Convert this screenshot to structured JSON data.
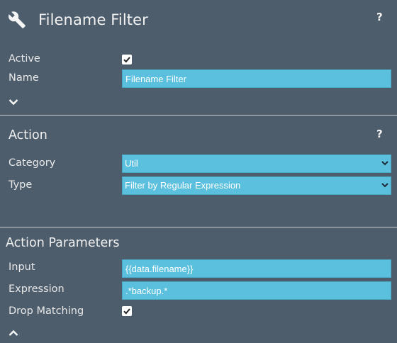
{
  "header": {
    "icon": "wrench-icon",
    "title": "Filename Filter",
    "help_label": "?"
  },
  "general": {
    "active_label": "Active",
    "active_checked": true,
    "name_label": "Name",
    "name_value": "Filename Filter",
    "toggle_icon": "chevron-down-icon"
  },
  "action": {
    "title": "Action",
    "help_label": "?",
    "category_label": "Category",
    "category_value": "Util",
    "category_options": [
      "Util"
    ],
    "type_label": "Type",
    "type_value": "Filter by Regular Expression",
    "type_options": [
      "Filter by Regular Expression"
    ]
  },
  "parameters": {
    "title": "Action Parameters",
    "input_label": "Input",
    "input_value": "{{data.filename}}",
    "expression_label": "Expression",
    "expression_value": ".*backup.*",
    "drop_matching_label": "Drop Matching",
    "drop_matching_checked": true,
    "toggle_icon": "chevron-up-icon"
  },
  "colors": {
    "background": "#4e5d6c",
    "field": "#5bc0de",
    "divider": "#c9ced3"
  }
}
